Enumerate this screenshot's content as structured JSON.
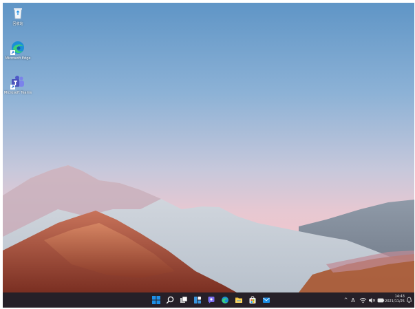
{
  "desktop": {
    "icons": [
      {
        "label": "回收站",
        "icon": "recycle-bin-icon"
      },
      {
        "label": "Microsoft Edge",
        "icon": "edge-icon"
      },
      {
        "label": "Microsoft Teams",
        "icon": "teams-icon"
      }
    ]
  },
  "taskbar": {
    "apps": [
      "start-icon",
      "search-icon",
      "task-view-icon",
      "widgets-icon",
      "chat-icon",
      "edge-icon",
      "file-explorer-icon",
      "store-icon",
      "mail-icon"
    ],
    "tray": {
      "chevron": "^",
      "input_indicator": "A",
      "time": "14:43",
      "date": "2021/11/25"
    }
  },
  "colors": {
    "taskbar_bg": "#262028",
    "start_blue": "#1e8fe6"
  }
}
